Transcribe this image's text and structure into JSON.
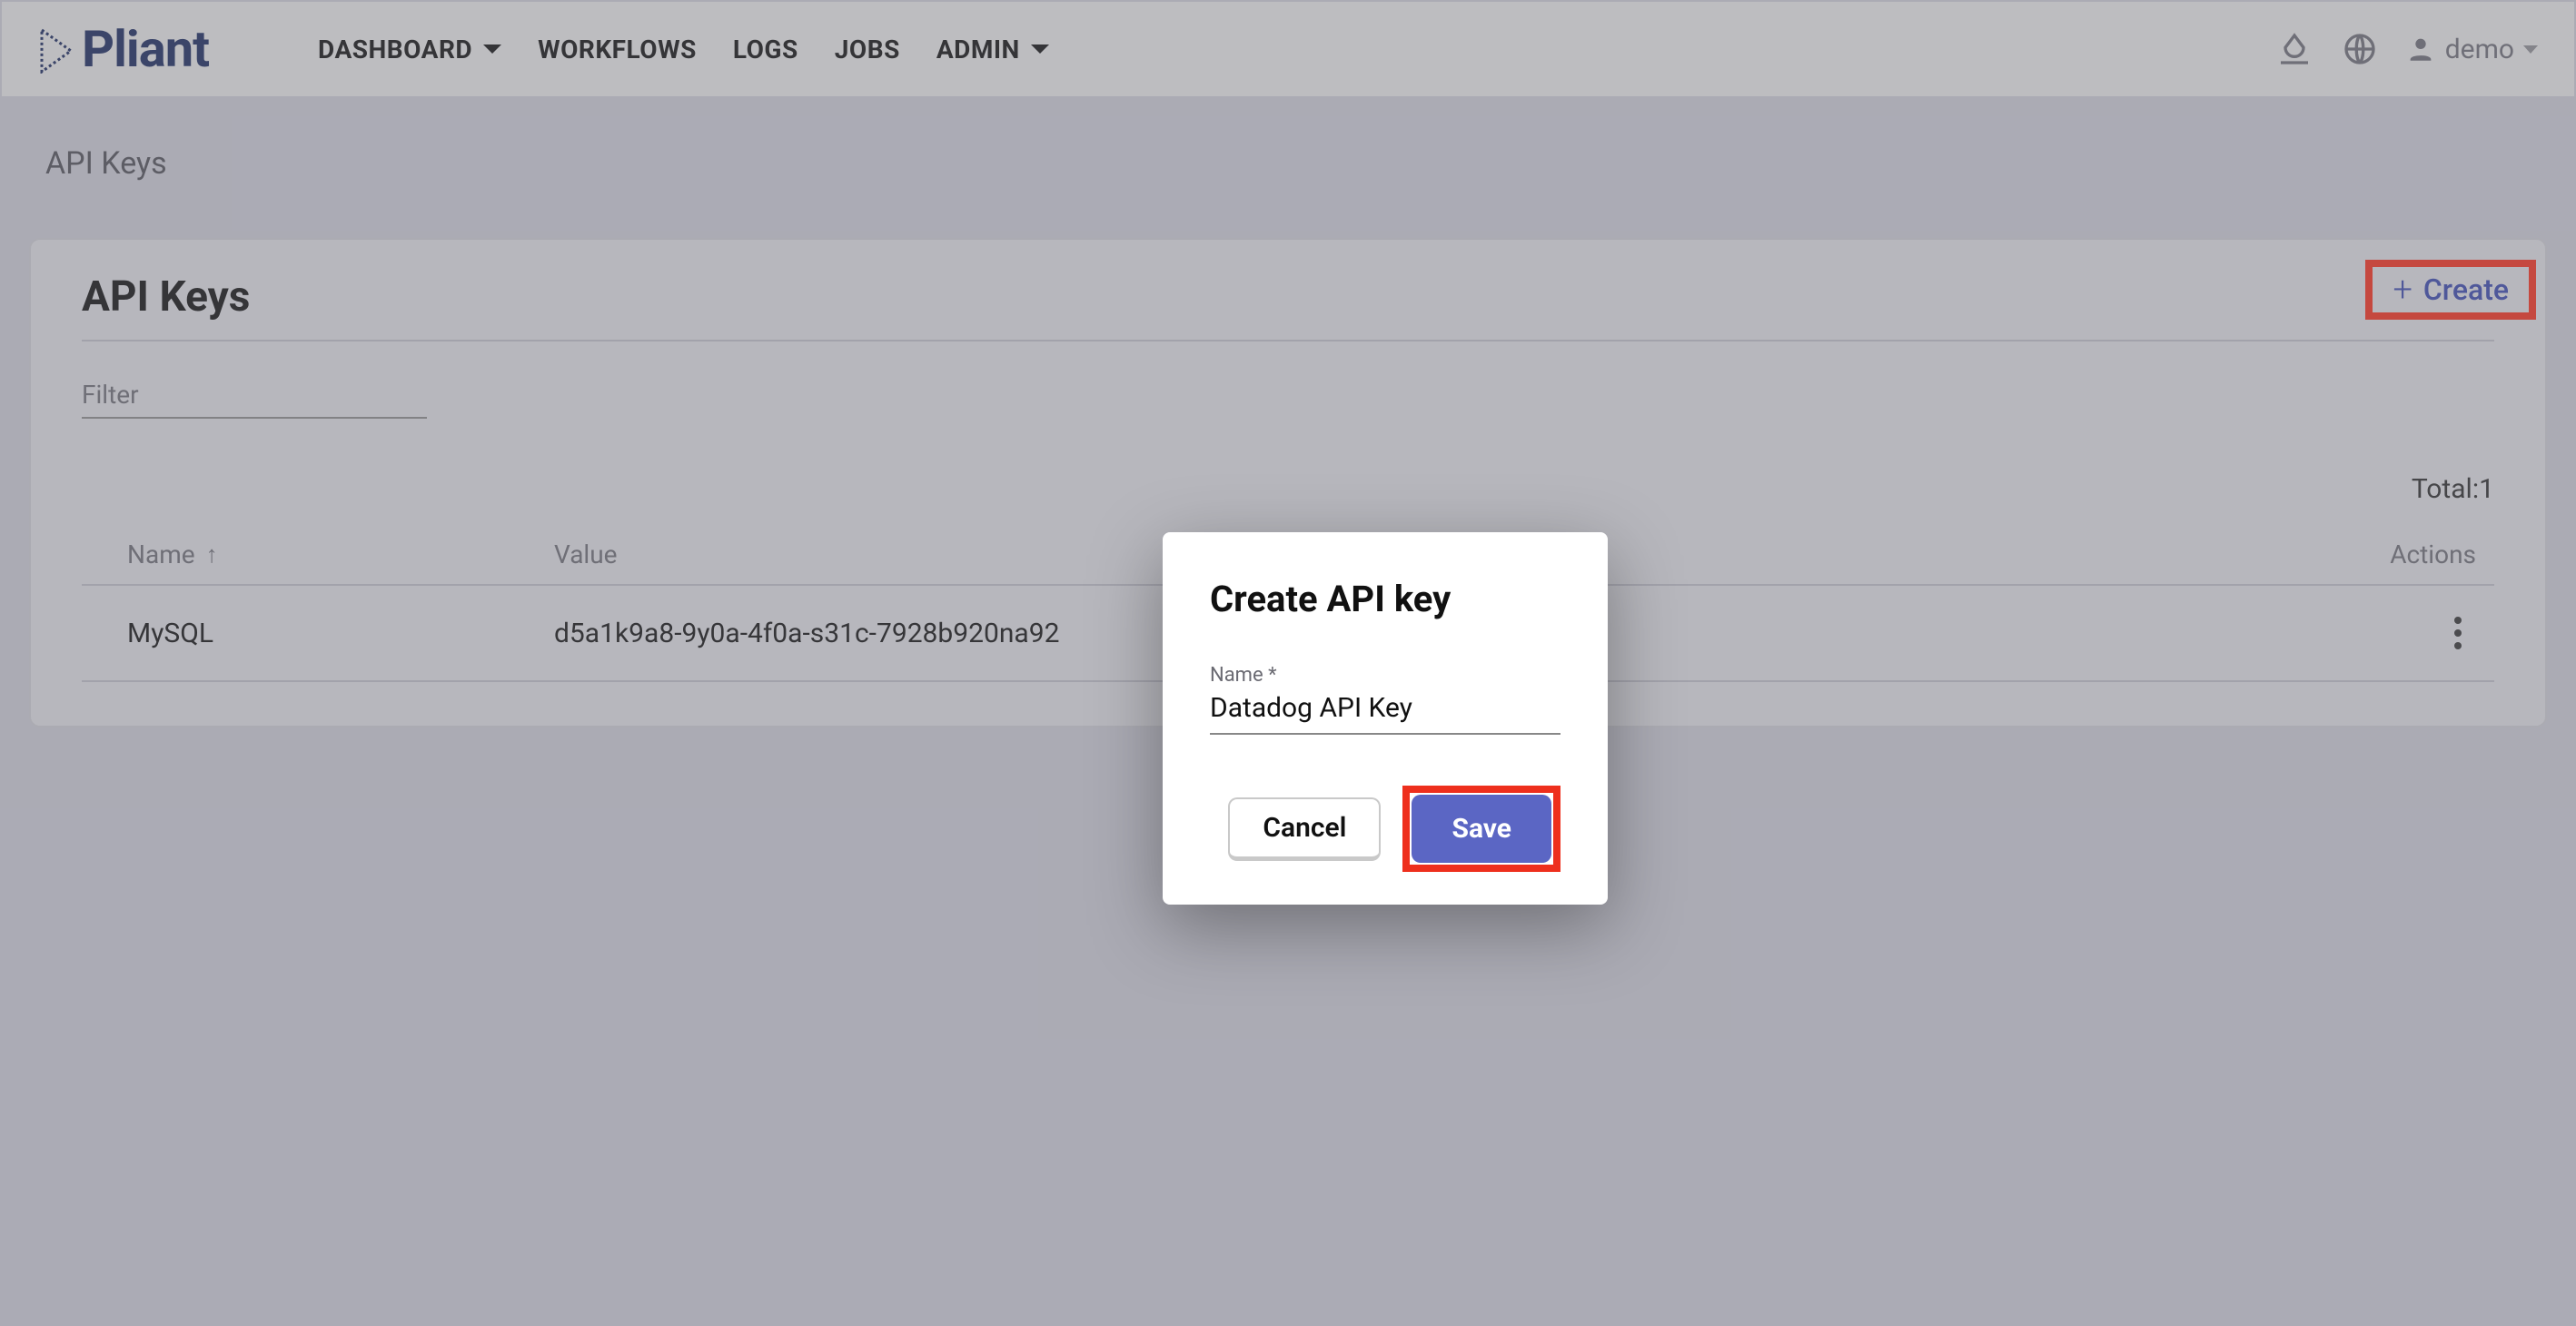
{
  "brand": {
    "name": "Pliant"
  },
  "nav": {
    "dashboard": "DASHBOARD",
    "workflows": "WORKFLOWS",
    "logs": "LOGS",
    "jobs": "JOBS",
    "admin": "ADMIN"
  },
  "user": {
    "name": "demo"
  },
  "breadcrumb": "API Keys",
  "panel": {
    "title": "API Keys",
    "create_label": "Create",
    "filter_placeholder": "Filter",
    "total_label": "Total: ",
    "total_value": "1",
    "columns": {
      "name": "Name",
      "value": "Value",
      "actions": "Actions"
    },
    "rows": [
      {
        "name": "MySQL",
        "value": "d5a1k9a8-9y0a-4f0a-s31c-7928b920na92"
      }
    ]
  },
  "modal": {
    "title": "Create API key",
    "name_label": "Name *",
    "name_value": "Datadog API Key",
    "cancel_label": "Cancel",
    "save_label": "Save"
  }
}
